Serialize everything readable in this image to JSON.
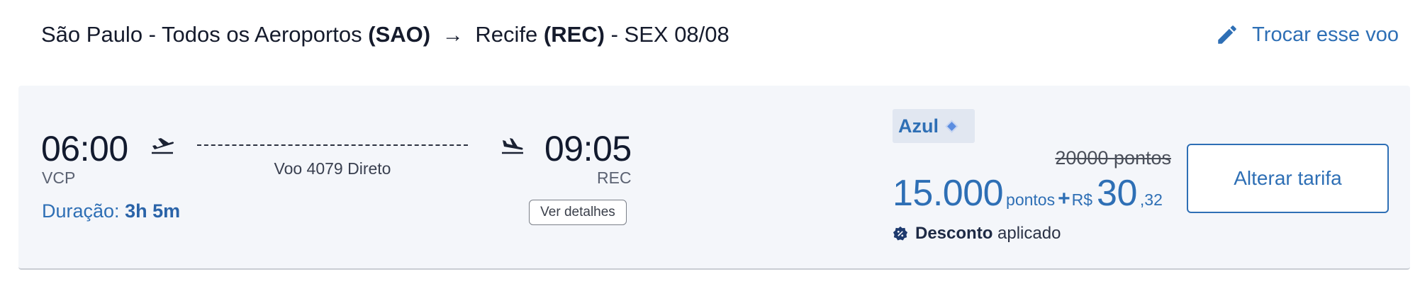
{
  "header": {
    "origin_city": "São Paulo - Todos os Aeroportos",
    "origin_code": "(SAO)",
    "arrow": "→",
    "destination_city": "Recife",
    "destination_code": "(REC)",
    "date": "- SEX 08/08",
    "change_flight_label": "Trocar esse voo",
    "change_flight_icon": "pencil-icon"
  },
  "flight": {
    "departure_time": "06:00",
    "departure_airport": "VCP",
    "arrival_time": "09:05",
    "arrival_airport": "REC",
    "flight_info": "Voo 4079 Direto",
    "duration_label": "Duração:",
    "duration_value": "3h 5m",
    "details_button": "Ver detalhes",
    "takeoff_icon": "airplane-takeoff-icon",
    "landing_icon": "airplane-landing-icon"
  },
  "fare": {
    "airline": "Azul",
    "old_price": "20000 pontos",
    "points": "15.000",
    "points_unit": "pontos",
    "plus": "+",
    "currency": "R$",
    "cash_integer": "30",
    "cash_cents": ",32",
    "discount_bold": "Desconto",
    "discount_rest": "aplicado",
    "change_fare_button": "Alterar tarifa"
  },
  "colors": {
    "accent": "#2e6fb5",
    "card_background": "#f4f6fa",
    "badge_background": "#e1e7f1"
  }
}
